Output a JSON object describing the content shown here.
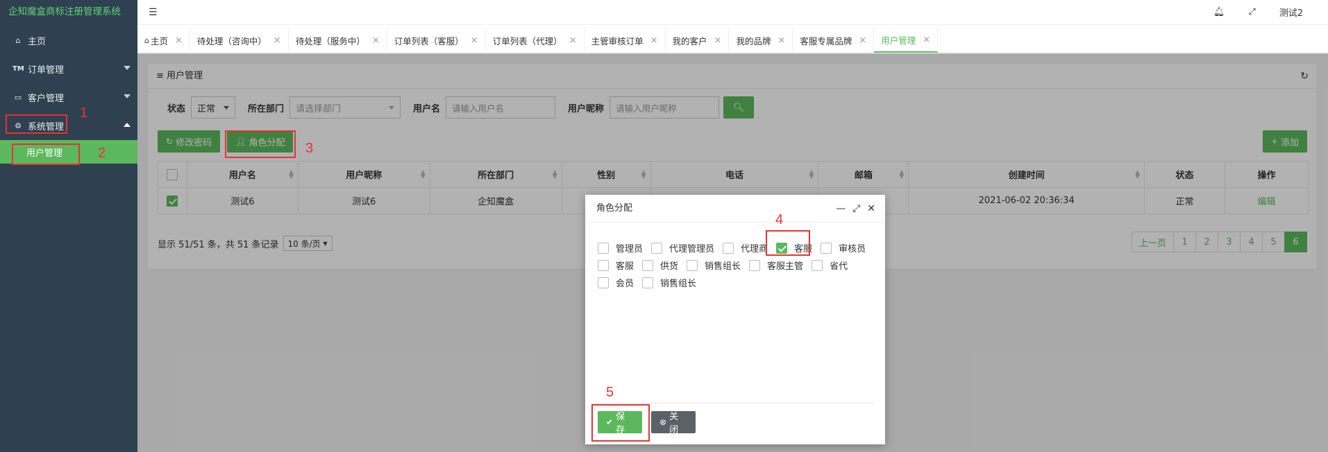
{
  "app": {
    "title": "企知魔盒商标注册管理系统"
  },
  "sidebar": {
    "items": [
      {
        "label": "主页",
        "icon": "home-icon"
      },
      {
        "label": "订单管理",
        "icon": "trademark-icon"
      },
      {
        "label": "客户管理",
        "icon": "monitor-icon"
      },
      {
        "label": "系统管理",
        "icon": "gear-icon"
      }
    ],
    "submenu": {
      "label": "用户管理"
    }
  },
  "topbar": {
    "user": "测试2"
  },
  "tabs": [
    {
      "label": "主页"
    },
    {
      "label": "待处理（咨询中）"
    },
    {
      "label": "待处理（服务中）"
    },
    {
      "label": "订单列表（客服）"
    },
    {
      "label": "订单列表（代理）"
    },
    {
      "label": "主管审核订单"
    },
    {
      "label": "我的客户"
    },
    {
      "label": "我的品牌"
    },
    {
      "label": "客服专属品牌"
    },
    {
      "label": "用户管理"
    }
  ],
  "panel": {
    "title": "用户管理"
  },
  "filters": {
    "status_label": "状态",
    "status_value": "正常",
    "dept_label": "所在部门",
    "dept_placeholder": "请选择部门",
    "username_label": "用户名",
    "username_placeholder": "请输入用户名",
    "nickname_label": "用户昵称",
    "nickname_placeholder": "请输入用户昵称"
  },
  "toolbar": {
    "change_password": "修改密码",
    "assign_role": "角色分配",
    "add": "添加"
  },
  "table": {
    "headers": [
      "用户名",
      "用户昵称",
      "所在部门",
      "性别",
      "电话",
      "邮箱",
      "创建时间",
      "状态",
      "操作"
    ],
    "rows": [
      {
        "username": "测试6",
        "nickname": "测试6",
        "dept": "企知魔盒",
        "gender": "",
        "phone": "",
        "email": "",
        "created": "2021-06-02 20:36:34",
        "status": "正常",
        "action": "编辑"
      }
    ]
  },
  "footer": {
    "info": "显示 51/51 条，共 51 条记录",
    "page_size": "10 条/页"
  },
  "pager": {
    "prev": "上一页",
    "pages": [
      "1",
      "2",
      "3",
      "4",
      "5",
      "6"
    ],
    "active": "6"
  },
  "modal": {
    "title": "角色分配",
    "roles_row1": [
      "管理员",
      "代理管理员",
      "代理商",
      "客服",
      "审核员"
    ],
    "roles_row2": [
      "客服",
      "供货",
      "销售组长",
      "客服主管",
      "省代"
    ],
    "roles_row3": [
      "会员",
      "销售组长"
    ],
    "save": "保存",
    "close": "关闭"
  },
  "annotations": [
    "1",
    "2",
    "3",
    "4",
    "5"
  ],
  "colors": {
    "sidebar_bg": "#2f4050",
    "accent": "#5cb85c",
    "annotation": "#e53333"
  }
}
